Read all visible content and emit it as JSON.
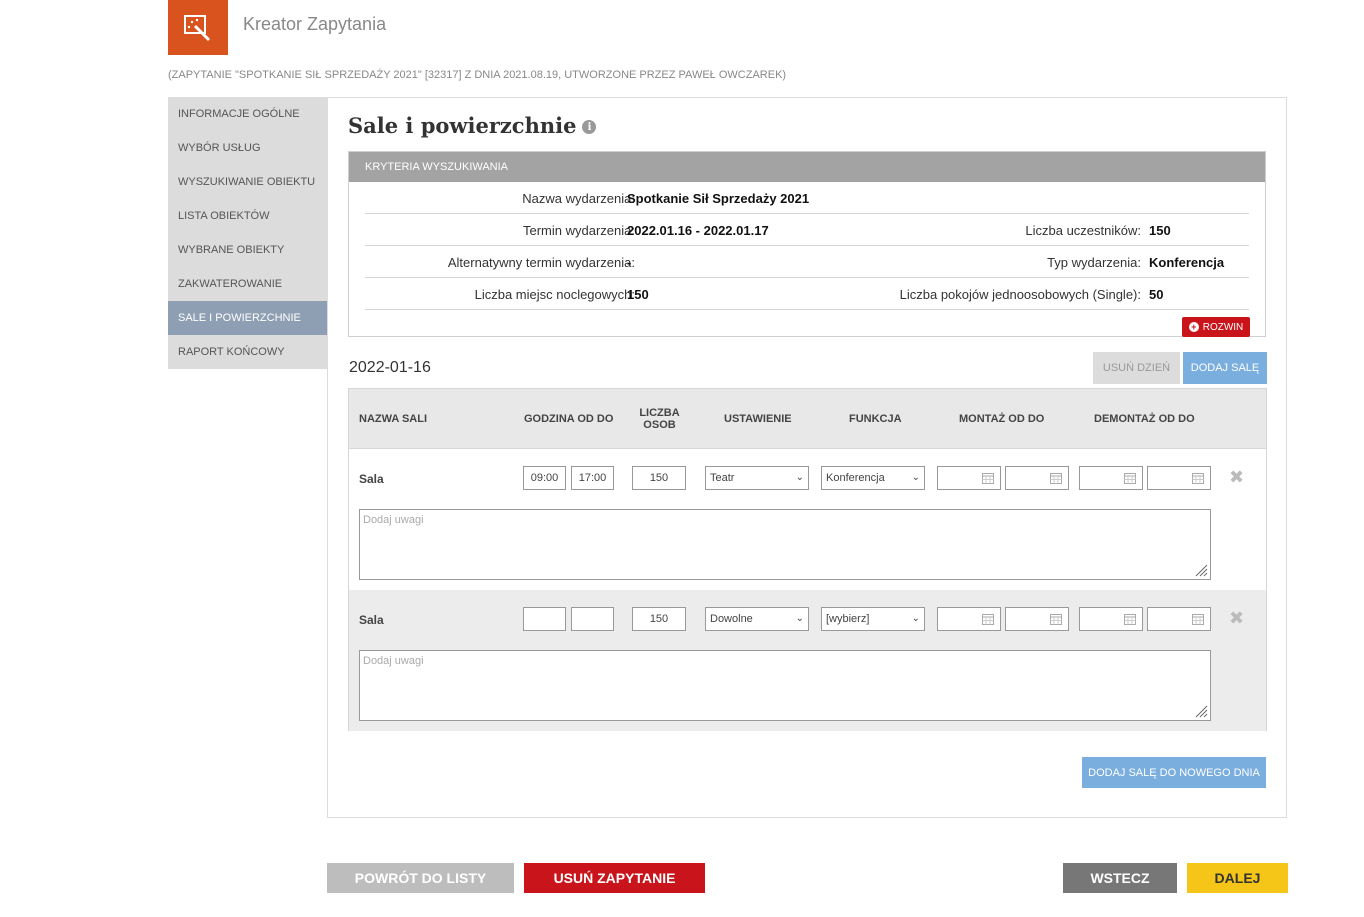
{
  "header": {
    "app_title": "Kreator Zapytania",
    "query_info": "(ZAPYTANIE \"SPOTKANIE SIŁ SPRZEDAŻY 2021\" [32317] Z DNIA 2021.08.19, UTWORZONE PRZEZ PAWEŁ OWCZAREK)",
    "logo_icon": "wizard-icon",
    "logo_color": "#d9531e"
  },
  "sidebar": {
    "items": [
      {
        "label": "INFORMACJE OGÓLNE"
      },
      {
        "label": "WYBÓR USŁUG"
      },
      {
        "label": "WYSZUKIWANIE OBIEKTU"
      },
      {
        "label": "LISTA OBIEKTÓW"
      },
      {
        "label": "WYBRANE OBIEKTY"
      },
      {
        "label": "ZAKWATEROWANIE"
      },
      {
        "label": "SALE I POWIERZCHNIE",
        "active": true
      },
      {
        "label": "RAPORT KOŃCOWY"
      }
    ]
  },
  "main": {
    "title": "Sale i powierzchnie",
    "info_icon": "info-icon"
  },
  "criteria": {
    "header": "KRYTERIA WYSZUKIWANIA",
    "event_name_label": "Nazwa wydarzenia:",
    "event_name": "Spotkanie Sił Sprzedaży 2021",
    "event_date_label": "Termin wydarzenia:",
    "event_date": "2022.01.16 - 2022.01.17",
    "participants_label": "Liczba uczestników:",
    "participants": "150",
    "alt_date_label": "Alternatywny termin wydarzenia:",
    "alt_date": "-",
    "event_type_label": "Typ wydarzenia:",
    "event_type": "Konferencja",
    "beds_label": "Liczba miejsc noclegowych:",
    "beds": "150",
    "single_rooms_label": "Liczba pokojów jednoosobowych (Single):",
    "single_rooms": "50",
    "expand_label": "ROZWIN"
  },
  "day": {
    "date": "2022-01-16",
    "remove_day_label": "USUŃ DZIEŃ",
    "add_room_label": "DODAJ SALĘ"
  },
  "table": {
    "col_name": "NAZWA SALI",
    "col_hours": "GODZINA OD DO",
    "col_persons_1": "LICZBA",
    "col_persons_2": "OSOB",
    "col_setup": "USTAWIENIE",
    "col_function": "FUNKCJA",
    "col_assembly": "MONTAŻ OD DO",
    "col_disassembly": "DEMONTAŻ OD DO",
    "rows": [
      {
        "name": "Sala",
        "from": "09:00",
        "to": "17:00",
        "persons": "150",
        "setup": "Teatr",
        "function": "Konferencja",
        "notes_placeholder": "Dodaj uwagi"
      },
      {
        "name": "Sala",
        "from": "",
        "to": "",
        "persons": "150",
        "setup": "Dowolne",
        "function": "[wybierz]",
        "notes_placeholder": "Dodaj uwagi"
      }
    ]
  },
  "add_room_new_day_label": "DODAJ SALĘ DO NOWEGO DNIA",
  "footer": {
    "back_to_list": "POWRÓT DO LISTY",
    "delete_query": "USUŃ ZAPYTANIE",
    "previous": "WSTECZ",
    "next": "DALEJ"
  }
}
